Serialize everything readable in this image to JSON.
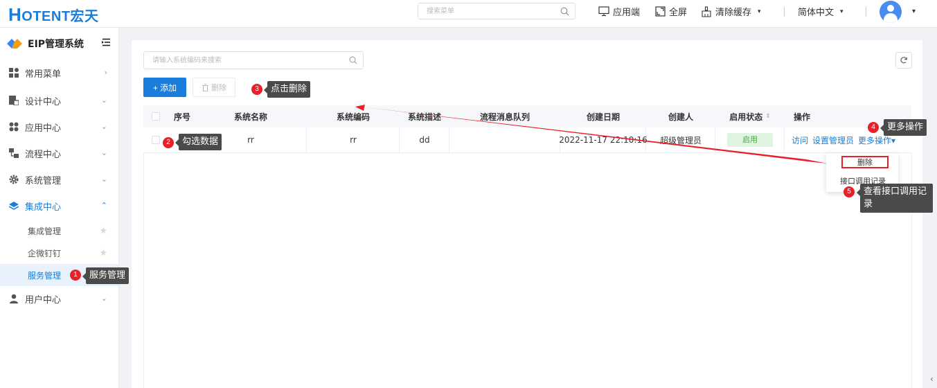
{
  "header": {
    "logo_first": "H",
    "logo_rest": "OTENT宏天",
    "search_placeholder": "搜索菜单",
    "app_label": "应用端",
    "fullscreen_label": "全屏",
    "clear_cache_label": "清除缓存",
    "language_label": "简体中文",
    "caret": "▾"
  },
  "sidebar": {
    "system_title": "EIP管理系统",
    "items": [
      {
        "label": "常用菜单",
        "icon": "grid-icon",
        "chevron": "›"
      },
      {
        "label": "设计中心",
        "icon": "design-icon",
        "chevron": "⌄"
      },
      {
        "label": "应用中心",
        "icon": "apps-icon",
        "chevron": "⌄"
      },
      {
        "label": "流程中心",
        "icon": "flow-icon",
        "chevron": "⌄"
      },
      {
        "label": "系统管理",
        "icon": "gear-icon",
        "chevron": "⌄"
      },
      {
        "label": "集成中心",
        "icon": "layers-icon",
        "chevron": "⌃"
      },
      {
        "label": "用户中心",
        "icon": "user-icon",
        "chevron": "⌄"
      }
    ],
    "sub_items": [
      {
        "label": "集成管理"
      },
      {
        "label": "企微钉钉"
      },
      {
        "label": "服务管理"
      }
    ]
  },
  "toolbar": {
    "search_placeholder": "请输入系统编码来搜索",
    "add_label": "+ 添加",
    "delete_label": "删除"
  },
  "table": {
    "headers": [
      "序号",
      "系统名称",
      "系统编码",
      "系统描述",
      "流程消息队列",
      "创建日期",
      "创建人",
      "启用状态",
      "操作"
    ],
    "rows": [
      {
        "name": "rr",
        "code": "rr",
        "desc": "dd",
        "queue": "",
        "created": "2022-11-17 22:10:16",
        "creator": "超级管理员",
        "status": "启用",
        "op_visit": "访问",
        "op_admin": "设置管理员",
        "op_more": "更多操作"
      }
    ]
  },
  "dropdown": {
    "delete": "删除",
    "api_log": "接口调用记录"
  },
  "annotations": [
    {
      "num": "1",
      "text": "服务管理"
    },
    {
      "num": "2",
      "text": "勾选数据"
    },
    {
      "num": "3",
      "text": "点击删除"
    },
    {
      "num": "4",
      "text": "更多操作"
    },
    {
      "num": "5",
      "text": "查看接口调用记录"
    }
  ],
  "colors": {
    "brand": "#1a7ddb",
    "annotation_red": "#e8202a",
    "status_green": "#45a845"
  }
}
